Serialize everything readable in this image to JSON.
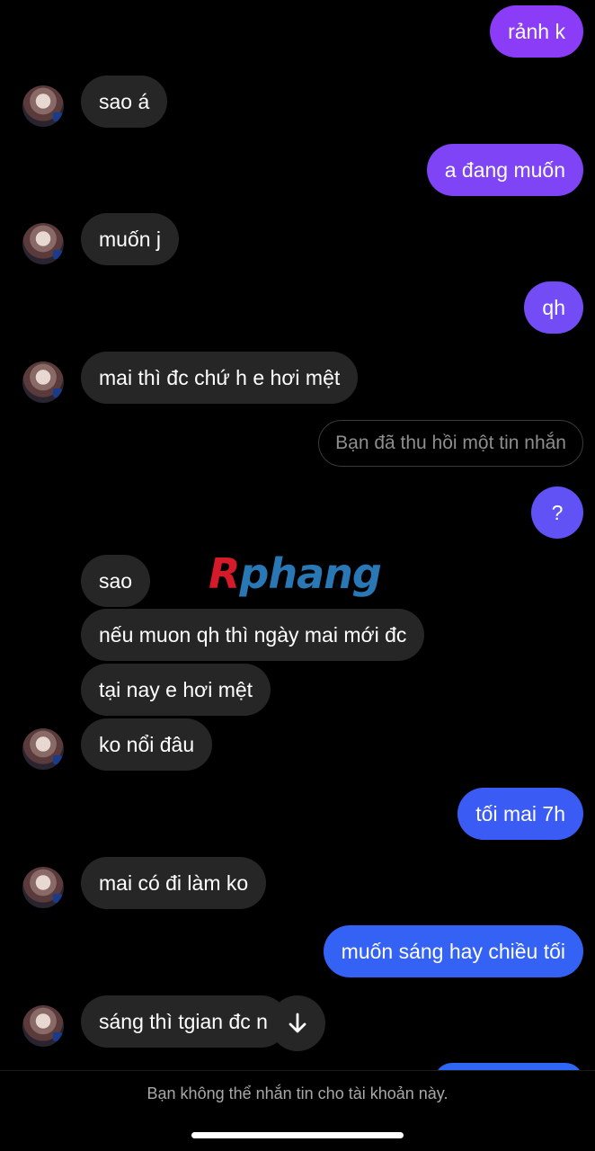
{
  "colors": {
    "outgoing_purple": "#8b3cf7",
    "outgoing_blue": "#3b5bf5",
    "incoming": "#262626",
    "background": "#000000"
  },
  "messages": [
    {
      "side": "out",
      "text": "rảnh k"
    },
    {
      "side": "in",
      "text": "sao á"
    },
    {
      "side": "out",
      "text": "a đang muốn"
    },
    {
      "side": "in",
      "text": "muốn j"
    },
    {
      "side": "out",
      "text": "qh"
    },
    {
      "side": "in",
      "text": "mai thì đc chứ h e hơi mệt"
    },
    {
      "side": "system",
      "text": "Bạn đã thu hồi một tin nhắn"
    },
    {
      "side": "out",
      "text": "?"
    },
    {
      "side": "in",
      "text": "sao"
    },
    {
      "side": "in",
      "text": "nếu muon qh thì ngày mai mới đc"
    },
    {
      "side": "in",
      "text": "tại nay e hơi mệt"
    },
    {
      "side": "in",
      "text": "ko nổi đâu"
    },
    {
      "side": "out",
      "text": "tối mai 7h"
    },
    {
      "side": "in",
      "text": "mai có đi làm ko"
    },
    {
      "side": "out",
      "text": "muốn sáng hay chiều tối"
    },
    {
      "side": "in",
      "text": "sáng thì tgian đc n"
    }
  ],
  "watermark": {
    "part1": "R",
    "part2": "phang"
  },
  "scroll_button_icon": "arrow-down-icon",
  "footer_text": "Bạn không thể nhắn tin cho tài khoản này."
}
